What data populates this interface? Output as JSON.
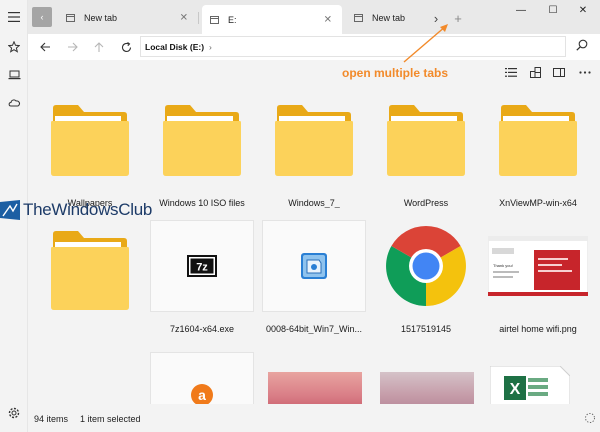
{
  "tabs": [
    {
      "label": "New tab",
      "close": "✕"
    },
    {
      "label": "E:",
      "close": "✕"
    },
    {
      "label": "New tab"
    }
  ],
  "tabstrip": {
    "scroll_right": "›",
    "new_tab": "+"
  },
  "window_controls": {
    "minimize": "—",
    "maximize": "☐",
    "close": "✕"
  },
  "address": {
    "path": "Local Disk (E:)",
    "chevron": "›"
  },
  "annotation": {
    "text": "open multiple tabs",
    "color": "#f28a2a"
  },
  "watermark": {
    "text": "TheWindowsClub"
  },
  "items": [
    {
      "name": "Wallpapers",
      "kind": "folder"
    },
    {
      "name": "Windows 10 ISO files",
      "kind": "folder"
    },
    {
      "name": "Windows_7_",
      "kind": "folder"
    },
    {
      "name": "WordPress",
      "kind": "folder"
    },
    {
      "name": "XnViewMP-win-x64",
      "kind": "folder"
    },
    {
      "name": "",
      "kind": "folder"
    },
    {
      "name": "7z1604-x64.exe",
      "kind": "7zip-icon"
    },
    {
      "name": "0008-64bit_Win7_Win...",
      "kind": "installer-icon"
    },
    {
      "name": "1517519145",
      "kind": "chrome-icon"
    },
    {
      "name": "airtel home wifi.png",
      "kind": "webpage-thumbnail"
    },
    {
      "name": "",
      "kind": "avast-icon"
    },
    {
      "name": "",
      "kind": "photo-thumbnail"
    },
    {
      "name": "",
      "kind": "photo-thumbnail"
    },
    {
      "name": "",
      "kind": "excel-icon"
    }
  ],
  "status": {
    "count": "94 items",
    "selected": "1 item selected"
  },
  "colors": {
    "folder_front": "#fcd25a",
    "folder_back": "#e9a917",
    "accent_orange": "#f28a2a"
  }
}
